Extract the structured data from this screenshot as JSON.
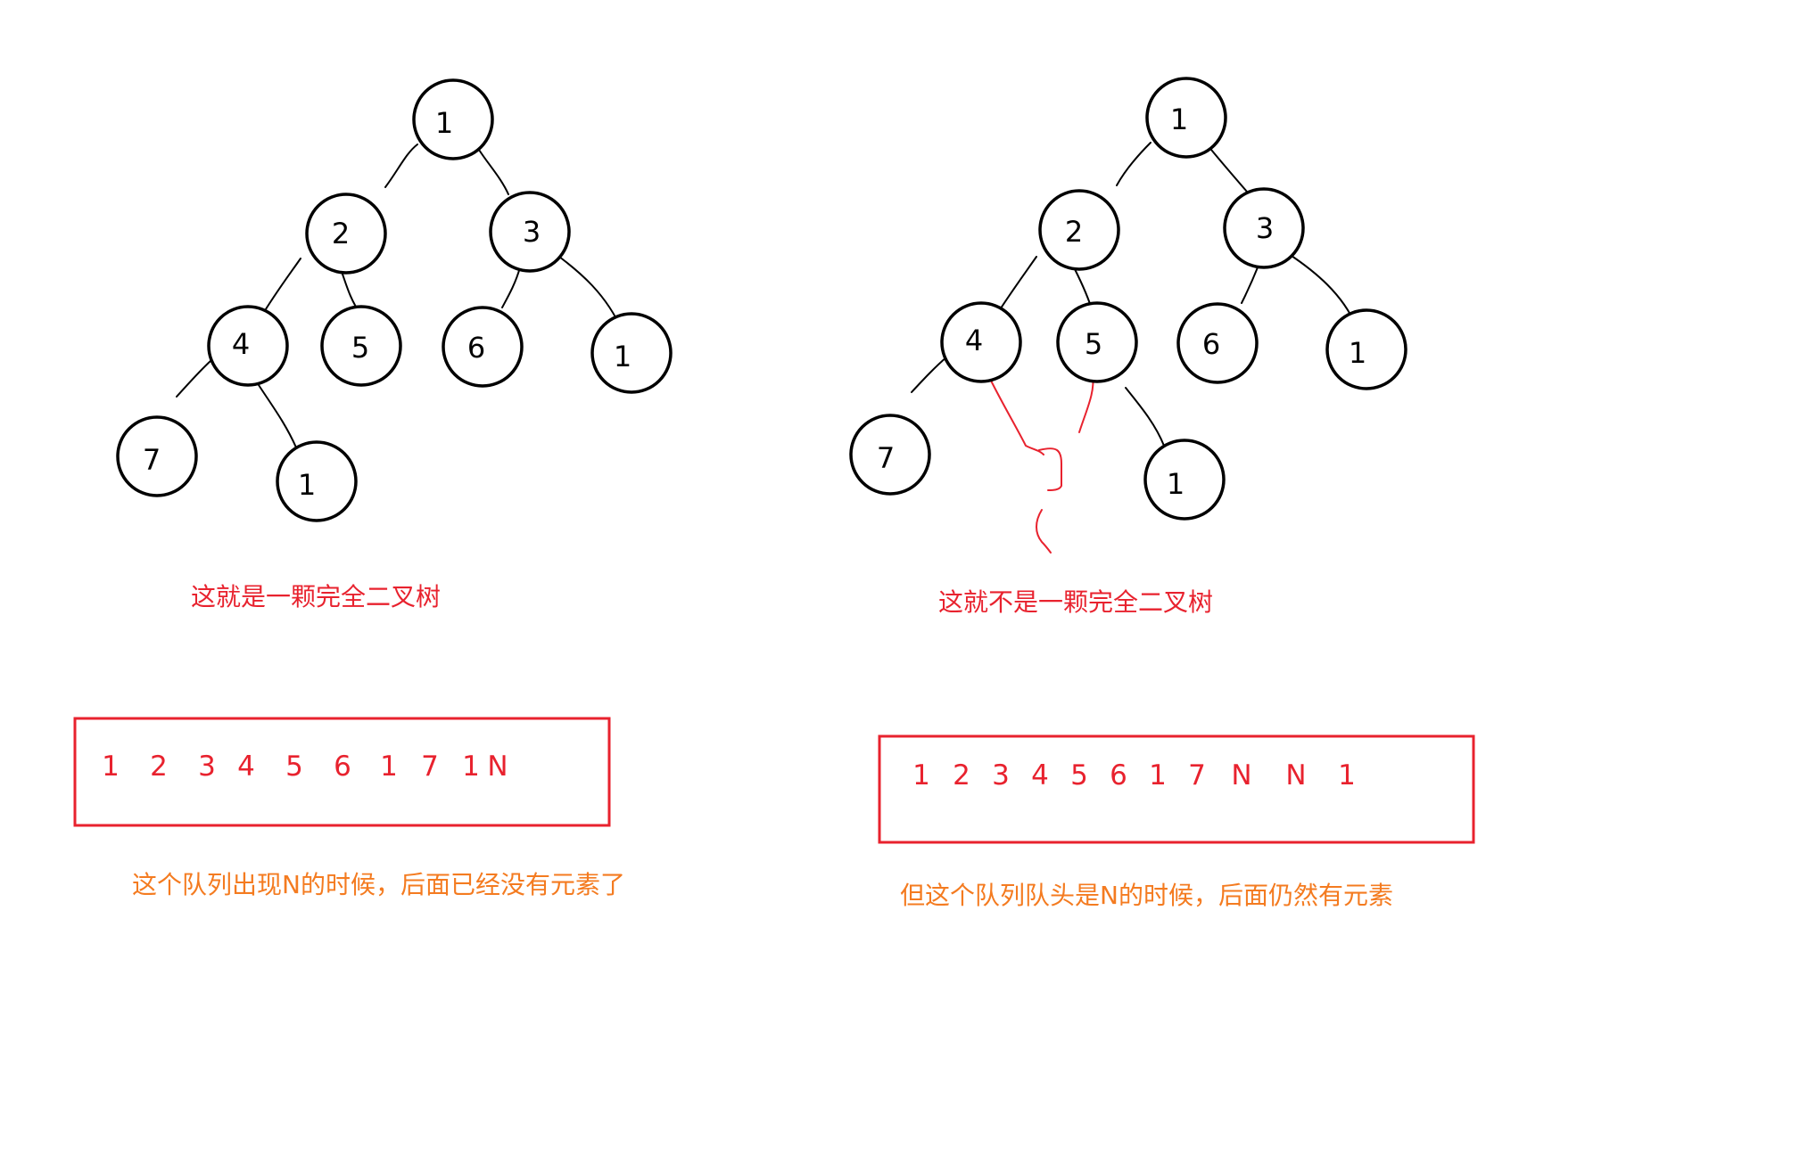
{
  "colors": {
    "caption_red": "#e8222e",
    "caption_orange": "#f47b20",
    "queue_border": "#e8222e",
    "queue_text": "#e8222e",
    "node_stroke": "#000000"
  },
  "left_panel": {
    "tree_nodes": [
      "1",
      "2",
      "3",
      "4",
      "5",
      "6",
      "1",
      "7",
      "1"
    ],
    "caption": "这就是一颗完全二叉树",
    "queue_items": [
      "1",
      "2",
      "3",
      "4",
      "5",
      "6",
      "1",
      "7",
      "1",
      "N"
    ],
    "note": "这个队列出现N的时候，后面已经没有元素了"
  },
  "right_panel": {
    "tree_nodes": [
      "1",
      "2",
      "3",
      "4",
      "5",
      "6",
      "1",
      "7",
      "1"
    ],
    "caption": "这就不是一颗完全二叉树",
    "queue_items": [
      "1",
      "2",
      "3",
      "4",
      "5",
      "6",
      "1",
      "7",
      "N",
      "N",
      "1"
    ],
    "note": "但这个队列队头是N的时候，后面仍然有元素"
  }
}
